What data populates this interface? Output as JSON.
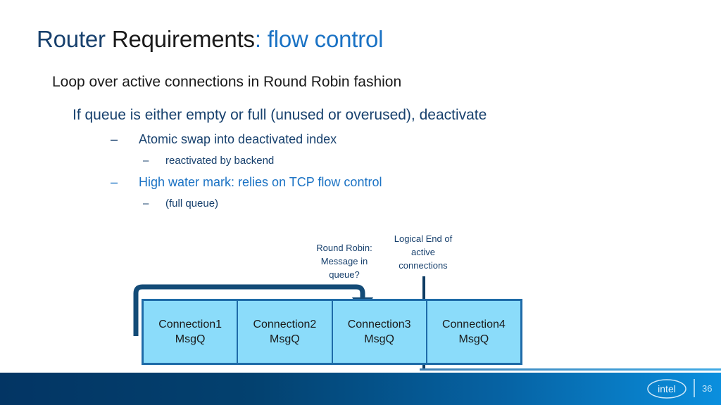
{
  "title": {
    "part1": "Router ",
    "part2": "Requirements",
    "part3": ": ",
    "part4": "flow control"
  },
  "bullets": {
    "l1": "Loop over active connections in Round Robin fashion",
    "l2": "If queue is either empty or full (unused or overused), deactivate",
    "l3a_dash": "–",
    "l3a": "Atomic swap into deactivated index",
    "l4a_dash": "–",
    "l4a": "reactivated by backend",
    "l3b_dash": "–",
    "l3b": "High water mark: relies on TCP flow control",
    "l4b_dash": "–",
    "l4b": "(full queue)"
  },
  "diagram": {
    "round_robin_label_line1": "Round Robin:",
    "round_robin_label_line2": "Message in",
    "round_robin_label_line3": "queue?",
    "logical_end_label_line1": "Logical End of",
    "logical_end_label_line2": "active",
    "logical_end_label_line3": "connections",
    "boxes": [
      {
        "name": "Connection1",
        "queue": "MsgQ"
      },
      {
        "name": "Connection2",
        "queue": "MsgQ"
      },
      {
        "name": "Connection3",
        "queue": "MsgQ"
      },
      {
        "name": "Connection4",
        "queue": "MsgQ"
      }
    ],
    "colors": {
      "box_fill": "#8BDCFA",
      "box_border": "#1E6BA8",
      "arrow": "#134B77",
      "divider": "#0E3C63"
    }
  },
  "footer": {
    "logo": "intel",
    "page_number": "36",
    "gradient_start": "#033564",
    "gradient_end": "#0A8FDE"
  }
}
